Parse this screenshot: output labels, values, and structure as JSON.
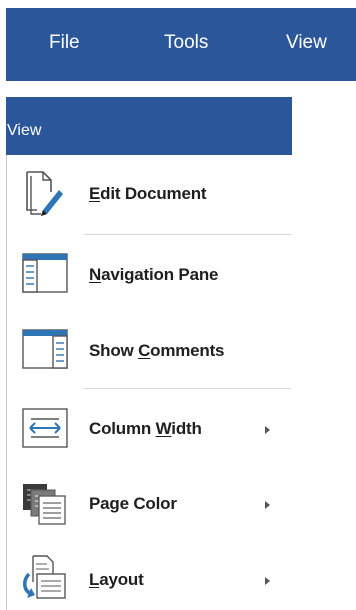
{
  "menubar": {
    "tabs": [
      {
        "label": "File"
      },
      {
        "label": "Tools"
      },
      {
        "label": "View"
      }
    ]
  },
  "panel": {
    "title": "View",
    "items": [
      {
        "pre": "",
        "ul": "E",
        "post": "dit Document",
        "icon": "edit-document-icon",
        "submenu": false
      },
      {
        "pre": "",
        "ul": "N",
        "post": "avigation Pane",
        "icon": "navigation-pane-icon",
        "submenu": false
      },
      {
        "pre": "Show ",
        "ul": "C",
        "post": "omments",
        "icon": "show-comments-icon",
        "submenu": false
      },
      {
        "pre": "Column ",
        "ul": "W",
        "post": "idth",
        "icon": "column-width-icon",
        "submenu": true
      },
      {
        "pre": "Page Color",
        "ul": "",
        "post": "",
        "icon": "page-color-icon",
        "submenu": true
      },
      {
        "pre": "",
        "ul": "L",
        "post": "ayout",
        "icon": "layout-icon",
        "submenu": true
      }
    ]
  },
  "colors": {
    "accent": "#2b579a",
    "icon_blue": "#2e75b6",
    "icon_gray": "#6b6b6b"
  }
}
